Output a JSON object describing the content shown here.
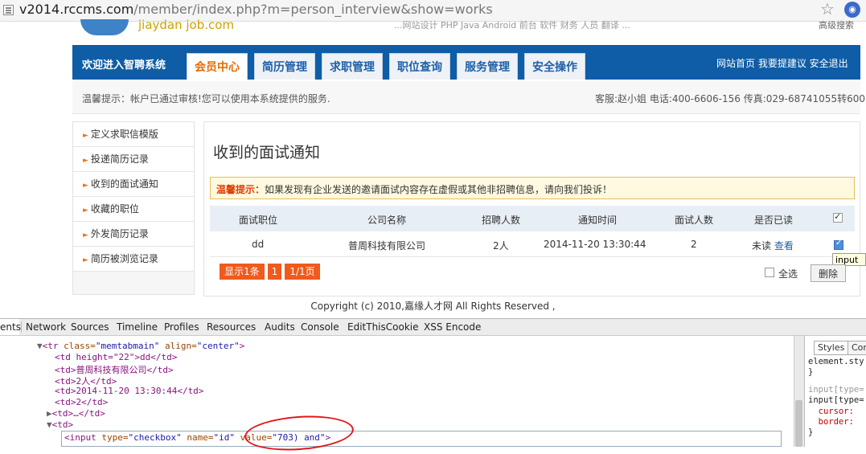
{
  "browser": {
    "url_host": "v2014.rccms.com",
    "url_path": "/member/index.php?m=person_interview&show=works"
  },
  "site": {
    "logo_text": "jiaydan job.com",
    "topnav_text": "...网站设计 PHP Java Android 前台 软件 财务 人员 翻译 ...",
    "topright_text": "高级搜索"
  },
  "nav": {
    "welcome": "欢迎进入智聘系统",
    "tabs": [
      "会员中心",
      "简历管理",
      "求职管理",
      "职位查询",
      "服务管理",
      "安全操作"
    ],
    "active_tab": 0,
    "links": "网站首页 我要提建议 安全退出"
  },
  "notice": {
    "left": "温馨提示：帐户已通过审核!您可以使用本系统提供的服务.",
    "right": "客服:赵小姐 电话:400-6606-156 传真:029-68741055转600"
  },
  "sidebar": {
    "items": [
      {
        "label": "定义求职信模版"
      },
      {
        "label": "投递简历记录"
      },
      {
        "label": "收到的面试通知"
      },
      {
        "label": "收藏的职位"
      },
      {
        "label": "外发简历记录"
      },
      {
        "label": "简历被浏览记录"
      }
    ]
  },
  "main": {
    "title": "收到的面试通知",
    "tip_label": "温馨提示：",
    "tip_text": "如果发现有企业发送的邀请面试内容存在虚假或其他非招聘信息，请向我们投诉！",
    "table": {
      "headers": [
        "面试职位",
        "公司名称",
        "招聘人数",
        "通知时间",
        "面试人数",
        "是否已读"
      ],
      "row": {
        "position": "dd",
        "company": "普周科技有限公司",
        "count": "2人",
        "time": "2014-11-20 13:30:44",
        "interviewers": "2",
        "read": "未读",
        "view": "查看"
      }
    },
    "tooltip": "input",
    "pager": {
      "shown": "显示1条",
      "page": "1",
      "pages": "1/1页"
    },
    "select_all": "全选",
    "delete_label": "删除"
  },
  "footer": {
    "copyright": "Copyright (c) 2010,嘉缘人才网 All Rights Reserved ,"
  },
  "devtools": {
    "tabs": [
      "ents",
      "Network",
      "Sources",
      "Timeline",
      "Profiles",
      "Resources",
      "Audits",
      "Console",
      "EditThisCookie",
      "XSS Encode"
    ],
    "code": {
      "l1_tag": "<tr ",
      "l1_a1": "class=",
      "l1_v1": "\"memtabmain\"",
      "l1_a2": " align=",
      "l1_v2": "\"center\"",
      "l1_end": ">",
      "l2": "<td height=\"22\">dd</td>",
      "l3": "<td>普周科技有限公司</td>",
      "l4": "<td>2人</td>",
      "l5": "<td>2014-11-20 13:30:44</td>",
      "l6": "<td>2</td>",
      "l7": "<td>…</td>",
      "l8": "<td>",
      "l9_a": "<input ",
      "l9_b": "type=",
      "l9_c": "\"checkbox\"",
      "l9_d": " name=",
      "l9_e": "\"id\"",
      "l9_f": " value=",
      "l9_g": "\"703) and\"",
      "l9_h": ">"
    },
    "styles": {
      "tab1": "Styles",
      "tab2": "Con",
      "l1": "element.sty",
      "l2": "}",
      "l3": "input[type=",
      "l4": "input[type=",
      "l5": "  cursor:",
      "l6": "  border:",
      "l7": "}"
    }
  }
}
